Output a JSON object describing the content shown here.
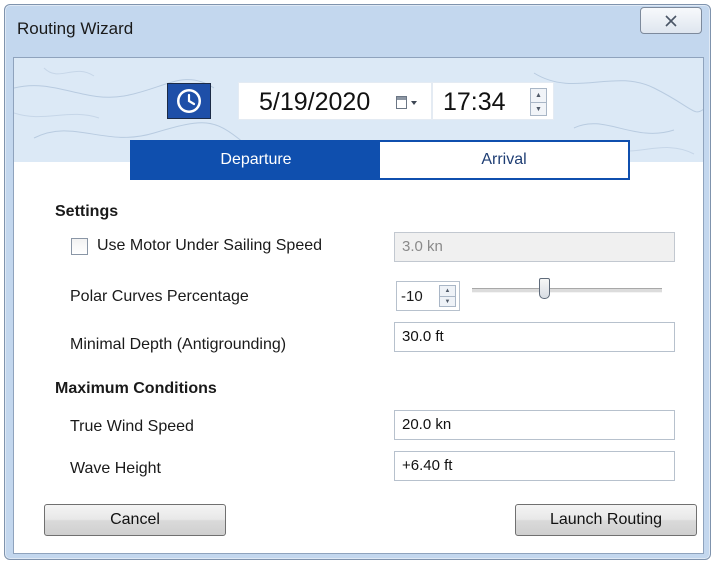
{
  "window": {
    "title": "Routing Wizard",
    "close_symbol": "X"
  },
  "datetime": {
    "date": "5/19/2020",
    "time": "17:34",
    "clock_icon": "clock-icon",
    "calendar_icon": "calendar-dropdown-icon"
  },
  "tabs": [
    {
      "label": "Departure",
      "selected": true
    },
    {
      "label": "Arrival",
      "selected": false
    }
  ],
  "settings": {
    "heading": "Settings",
    "use_motor_label": "Use Motor Under Sailing Speed",
    "use_motor_checked": false,
    "motor_speed": "3.0 kn",
    "polar_label": "Polar Curves Percentage",
    "polar_value": "-10",
    "polar_slider_fraction": 0.38,
    "min_depth_label": "Minimal Depth (Antigrounding)",
    "min_depth_value": "30.0 ft"
  },
  "max_conditions": {
    "heading": "Maximum Conditions",
    "wind_label": "True Wind Speed",
    "wind_value": "20.0 kn",
    "wave_label": "Wave Height",
    "wave_value": "+6.40 ft"
  },
  "buttons": {
    "cancel": "Cancel",
    "launch": "Launch Routing"
  },
  "colors": {
    "accent": "#0f4fae",
    "window_frame": "#c3d7ee"
  }
}
